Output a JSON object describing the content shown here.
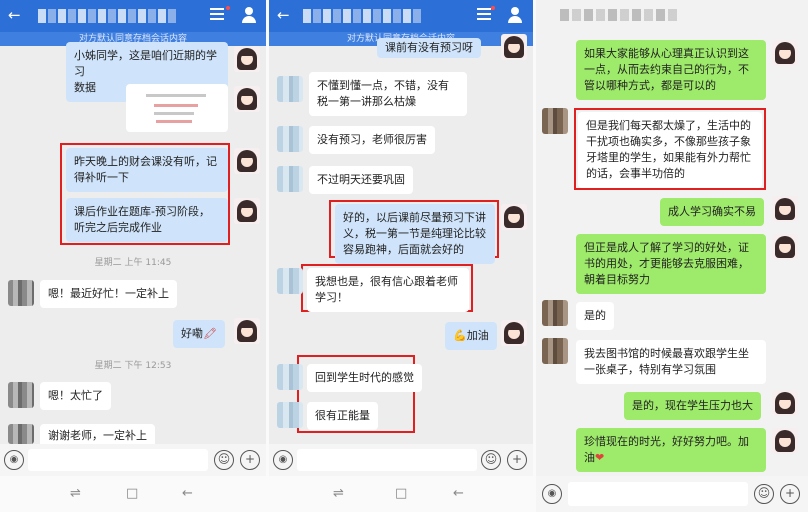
{
  "colors": {
    "header": "#2c6fd7",
    "blue_bubble": "#cfe4fb",
    "green_bubble": "#9eea6a",
    "highlight": "#e02020"
  },
  "panel1": {
    "notice": "对方默认同意存档会话内容",
    "msg_top": "小冰同学，这是咱们近期的学习数据",
    "msg_top_visible": "小姊同学，这是咱们近期的学习\n数据",
    "msg_a": "昨天晚上的财会课没有听，记得补听一下",
    "msg_b": "课后作业在题库-预习阶段，听完之后完成作业",
    "time1": "星期二 上午 11:45",
    "reply1": "嗯！最近好忙！一定补上",
    "msg_c": "好嘞",
    "time2": "星期二 下午 12:53",
    "reply2": "嗯！太忙了",
    "reply3": "谢谢老师，一定补上"
  },
  "panel2": {
    "notice": "对方默认同意存档会话内容",
    "msg_top": "课前有没有预习呀",
    "r1": "不懂到懂一点，不错，没有税一第一讲那么枯燥",
    "r2": "没有预习，老师很厉害",
    "r3": "不过明天还要巩固",
    "t1": "好的，以后课前尽量预习下讲义，税一第一节是纯理论比较容易跑神，后面就会好的",
    "r4": "我想也是，很有信心跟着老师学习！",
    "t2": "加油",
    "r5": "回到学生时代的感觉",
    "r6": "很有正能量"
  },
  "panel3": {
    "t1": "如果大家能够从心理真正认识到这一点，从而去约束自己的行为，不管以哪种方式，都是可以的",
    "r1": "但是我们每天都太燥了，生活中的干扰项也确实多，不像那些孩子象牙塔里的学生，如果能有外力帮忙的话，会事半功倍的",
    "t2": "成人学习确实不易",
    "t3": "但正是成人了解了学习的好处，证书的用处，才更能够去克服困难，朝着目标努力",
    "r2": "是的",
    "r3": "我去图书馆的时候最喜欢跟学生坐一张桌子，特别有学习氛围",
    "t4": "是的，现在学生压力也大",
    "t5": "珍惜现在的时光，好好努力吧。加油"
  },
  "icons": {
    "back": "back-arrow-icon",
    "menu": "menu-icon",
    "profile": "person-icon",
    "voice": "voice-icon",
    "emoji": "emoji-icon",
    "plus": "plus-icon"
  },
  "nav": {
    "recent": "⇌",
    "home": "□",
    "back": "←"
  },
  "input": {
    "voice": "◉",
    "emoji": "☺",
    "plus": "+"
  }
}
